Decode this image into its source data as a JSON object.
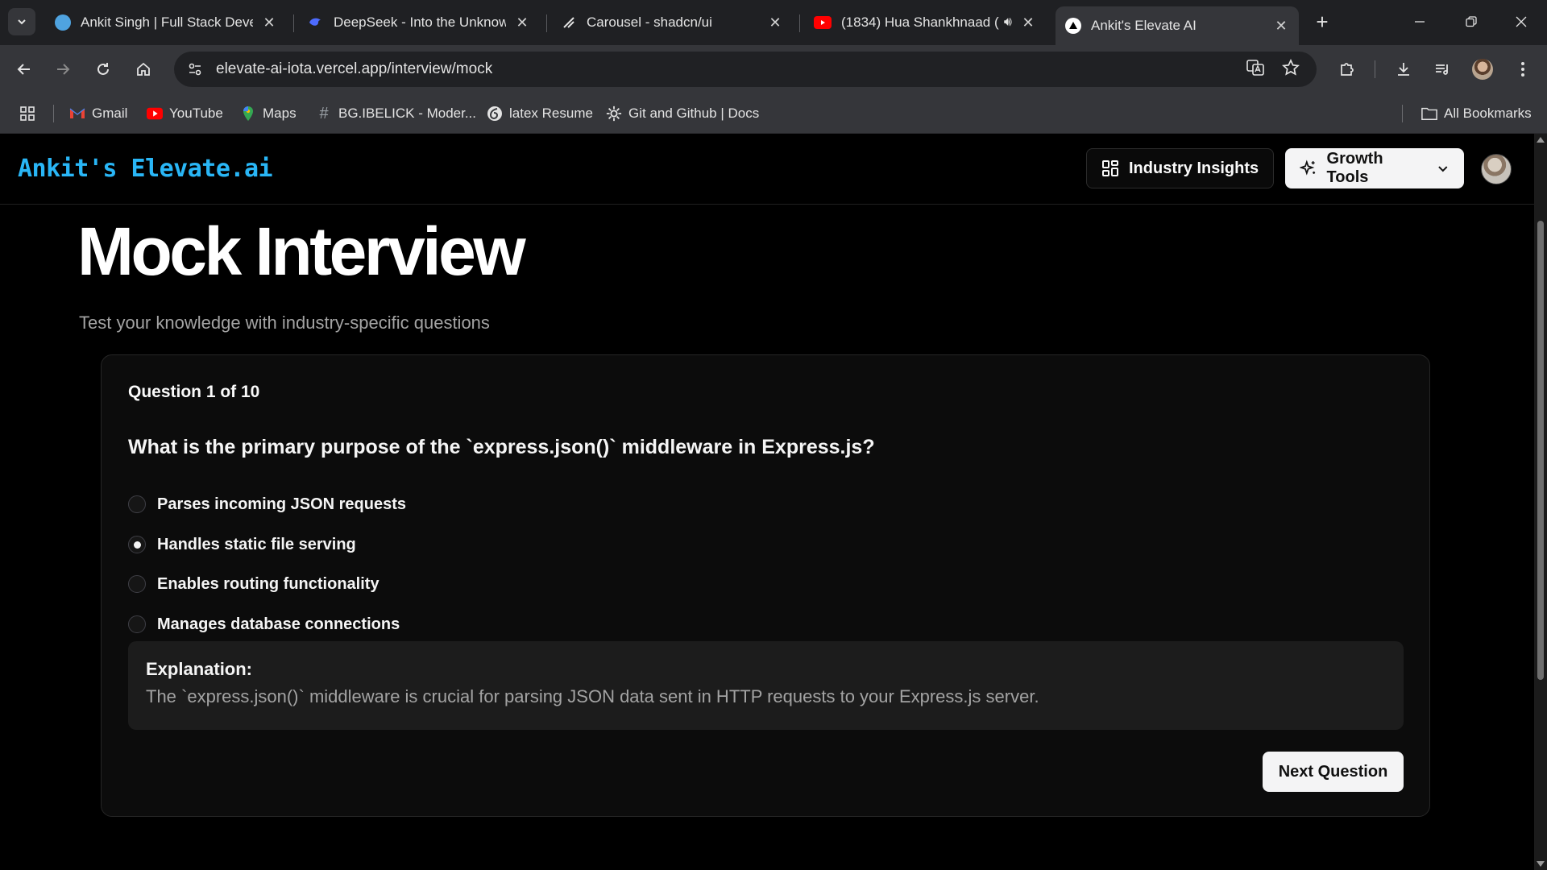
{
  "browser": {
    "tabs": [
      {
        "title": "Ankit Singh | Full Stack Develo",
        "icon": "site-globe-icon"
      },
      {
        "title": "DeepSeek - Into the Unknown",
        "icon": "deepseek-icon"
      },
      {
        "title": "Carousel - shadcn/ui",
        "icon": "shadcn-icon"
      },
      {
        "title": "(1834) Hua Shankhnaad (",
        "icon": "youtube-icon"
      },
      {
        "title": "Ankit's Elevate AI",
        "icon": "vercel-icon"
      }
    ],
    "url": "elevate-ai-iota.vercel.app/interview/mock",
    "bookmarks": [
      {
        "label": "Gmail"
      },
      {
        "label": "YouTube"
      },
      {
        "label": "Maps"
      },
      {
        "label": "BG.IBELICK - Moder..."
      },
      {
        "label": "latex Resume"
      },
      {
        "label": "Git and Github | Docs"
      }
    ],
    "all_bookmarks_label": "All Bookmarks"
  },
  "header": {
    "logo": "Ankit's Elevate.ai",
    "industry_insights_label": "Industry Insights",
    "growth_tools_label": "Growth Tools"
  },
  "main": {
    "title": "Mock Interview",
    "subtitle": "Test your knowledge with industry-specific questions",
    "question_counter": "Question 1 of 10",
    "question": "What is the primary purpose of the `express.json()` middleware in Express.js?",
    "options": [
      {
        "label": "Parses incoming JSON requests",
        "selected": false
      },
      {
        "label": "Handles static file serving",
        "selected": true
      },
      {
        "label": "Enables routing functionality",
        "selected": false
      },
      {
        "label": "Manages database connections",
        "selected": false
      }
    ],
    "explanation_title": "Explanation:",
    "explanation_text": "The `express.json()` middleware is crucial for parsing JSON data sent in HTTP requests to your Express.js server.",
    "next_label": "Next Question"
  },
  "colors": {
    "logo": "#29b6f6",
    "page_bg": "#000000",
    "card_bg": "#0c0c0c",
    "button_light": "#f4f4f5"
  }
}
